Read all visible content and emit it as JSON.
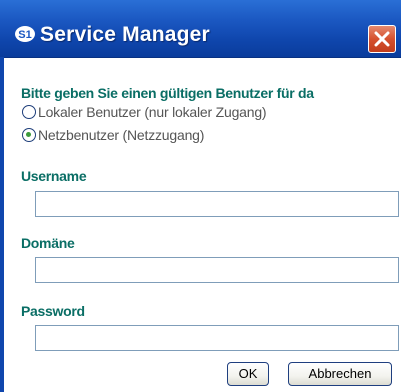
{
  "window": {
    "title": "Service Manager",
    "title_icon": "service-manager-logo-icon",
    "close_icon": "close-icon",
    "colors": {
      "titlebar": "#1b58c2",
      "close_button": "#d6512f",
      "label_text": "#0a6e65",
      "radio_fill": "#3c9a3c"
    }
  },
  "intro_text": "Bitte geben Sie einen gültigen Benutzer für da",
  "user_type": {
    "options": [
      {
        "label": "Lokaler Benutzer (nur lokaler Zugang)",
        "selected": false
      },
      {
        "label": "Netzbenutzer (Netzzugang)",
        "selected": true
      }
    ]
  },
  "fields": {
    "username": {
      "label": "Username",
      "value": ""
    },
    "domain": {
      "label": "Domäne",
      "value": ""
    },
    "password": {
      "label": "Password",
      "value": ""
    }
  },
  "buttons": {
    "ok": "OK",
    "cancel": "Abbrechen"
  }
}
